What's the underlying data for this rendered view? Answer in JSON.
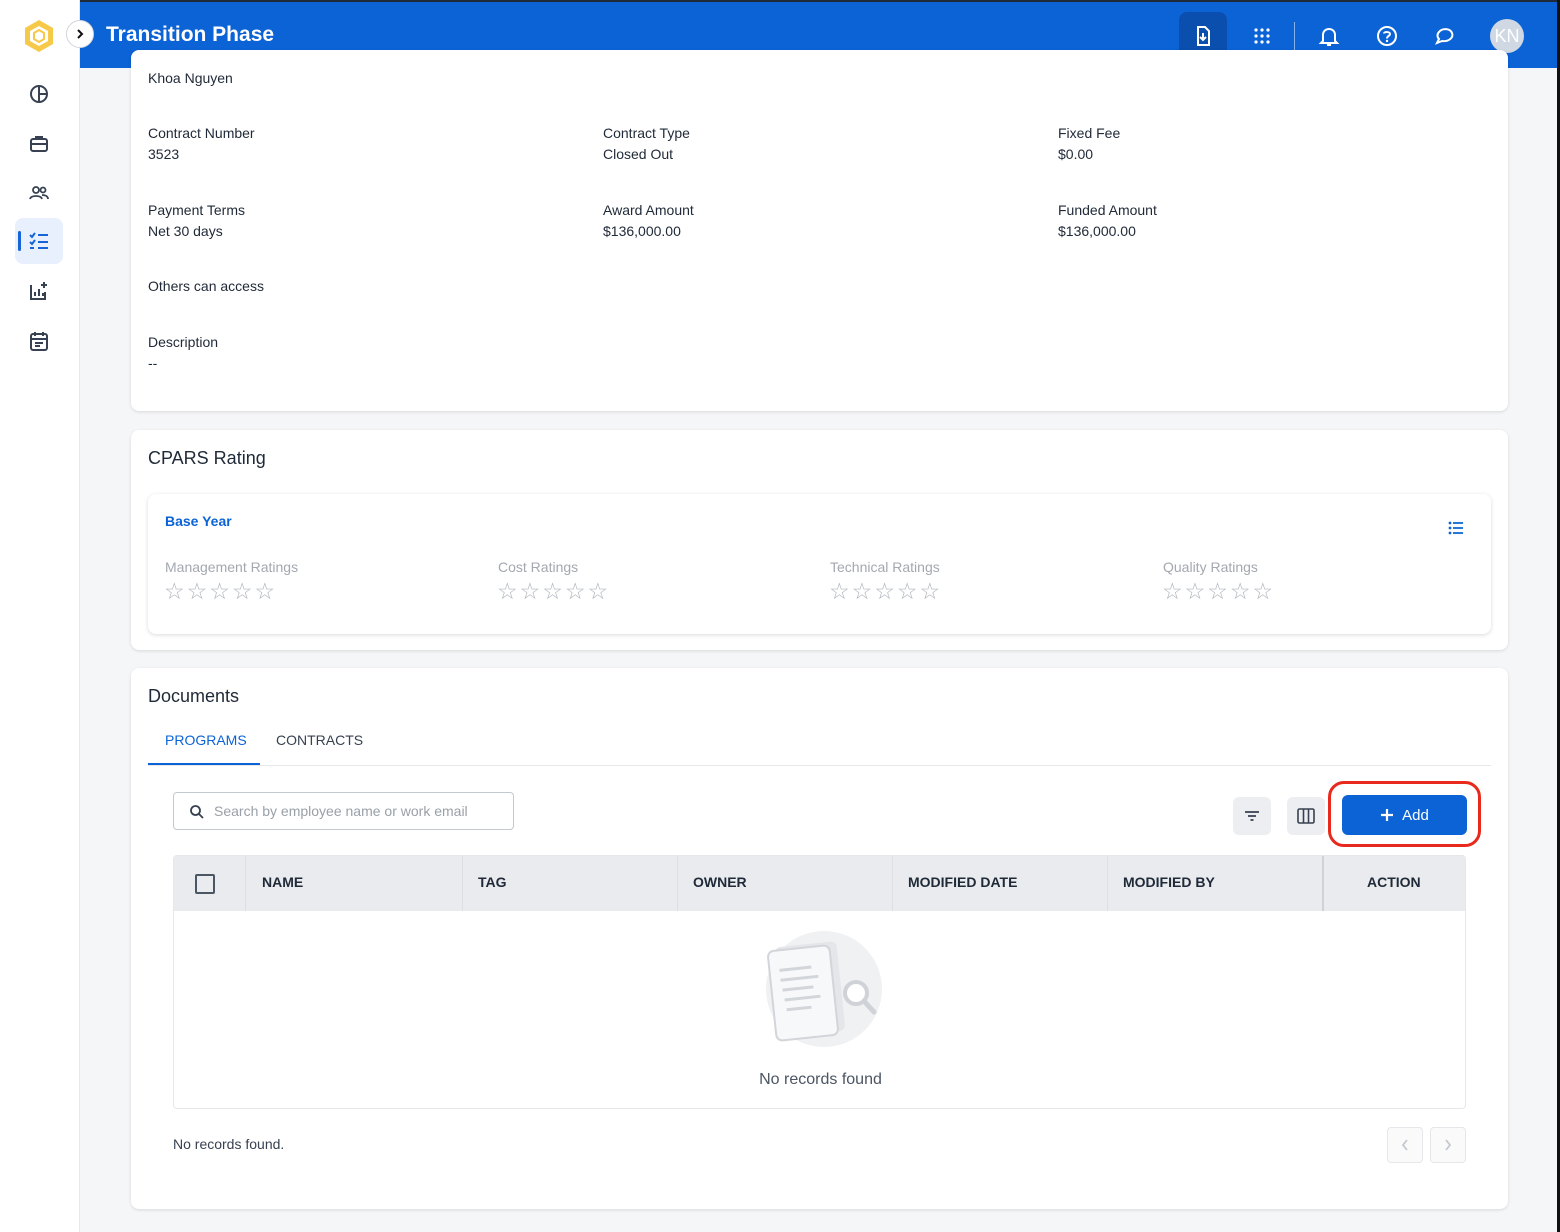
{
  "app": {
    "title": "Transition Phase",
    "user_initials": "KN"
  },
  "topbar_icons": [
    "download-document-icon",
    "apps-grid-icon",
    "bell-icon",
    "help-icon",
    "chat-icon"
  ],
  "sidebar": {
    "items": [
      {
        "name": "dashboard-icon",
        "active": false
      },
      {
        "name": "briefcase-icon",
        "active": false
      },
      {
        "name": "people-icon",
        "active": false
      },
      {
        "name": "checklist-icon",
        "active": true
      },
      {
        "name": "add-chart-icon",
        "active": false
      },
      {
        "name": "calendar-icon",
        "active": false
      }
    ]
  },
  "details": {
    "owner_name": "Khoa Nguyen",
    "contract_number_label": "Contract Number",
    "contract_number": "3523",
    "contract_type_label": "Contract Type",
    "contract_type": "Closed Out",
    "fixed_fee_label": "Fixed Fee",
    "fixed_fee": "$0.00",
    "payment_terms_label": "Payment Terms",
    "payment_terms": "Net 30 days",
    "award_amount_label": "Award Amount",
    "award_amount": "$136,000.00",
    "funded_amount_label": "Funded Amount",
    "funded_amount": "$136,000.00",
    "others_access_label": "Others can access",
    "description_label": "Description",
    "description": "--"
  },
  "cpars": {
    "title": "CPARS Rating",
    "period": "Base Year",
    "ratings": [
      {
        "label": "Management Ratings",
        "stars": 0,
        "max": 5
      },
      {
        "label": "Cost Ratings",
        "stars": 0,
        "max": 5
      },
      {
        "label": "Technical Ratings",
        "stars": 0,
        "max": 5
      },
      {
        "label": "Quality Ratings",
        "stars": 0,
        "max": 5
      }
    ]
  },
  "documents": {
    "title": "Documents",
    "tabs": [
      {
        "label": "PROGRAMS",
        "active": true
      },
      {
        "label": "CONTRACTS",
        "active": false
      }
    ],
    "search_placeholder": "Search by employee name or work email",
    "add_label": "Add",
    "columns": [
      "NAME",
      "TAG",
      "OWNER",
      "MODIFIED DATE",
      "MODIFIED BY",
      "ACTION"
    ],
    "rows": [],
    "empty_message": "No records found",
    "footer_message": "No records found."
  },
  "colors": {
    "brand": "#0b63d6",
    "highlight": "#e8291c"
  }
}
